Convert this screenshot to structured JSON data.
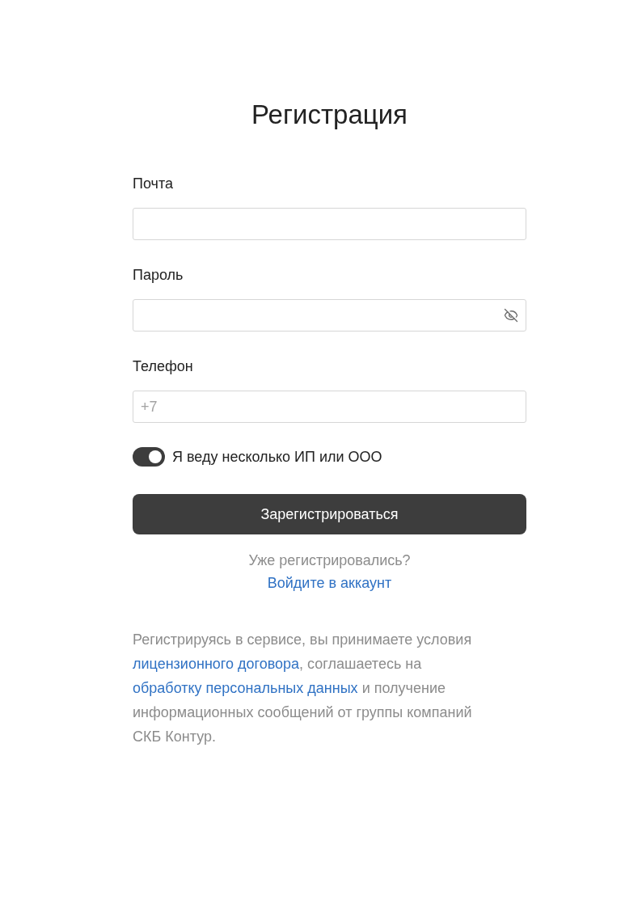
{
  "title": "Регистрация",
  "fields": [
    {
      "label": "Почта",
      "kind": "text"
    },
    {
      "label": "Пароль",
      "kind": "password"
    },
    {
      "label": "Телефон",
      "kind": "text",
      "placeholder": "+7"
    }
  ],
  "toggle": {
    "label": "Я веду несколько ИП или ООО",
    "on": true
  },
  "submit_button": "Зарегистрироваться",
  "login_prompt": {
    "text": "Уже регистрировались?",
    "link": "Войдите в аккаунт"
  },
  "legal_text": [
    {
      "kind": "text",
      "text": "Регистрируясь в сервисе, вы принимаете условия "
    },
    {
      "kind": "link",
      "text": "лицензионного договора"
    },
    {
      "kind": "text",
      "text": ", соглашаетесь на "
    },
    {
      "kind": "link",
      "text": "обработку персональных данных"
    },
    {
      "kind": "text",
      "text": " и получение информационных сообщений от группы компаний СКБ Контур."
    }
  ]
}
